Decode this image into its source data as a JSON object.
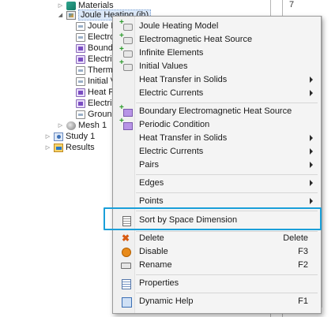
{
  "tree": {
    "items": [
      {
        "label": "Materials",
        "icon": "materials-icon"
      },
      {
        "label": "Joule Heating (jh)",
        "icon": "joule-heating-icon"
      },
      {
        "label": "Joule H",
        "icon": "node-icon"
      },
      {
        "label": "Electro",
        "icon": "node-icon"
      },
      {
        "label": "Bound",
        "icon": "boundary-icon"
      },
      {
        "label": "Electric",
        "icon": "boundary-icon"
      },
      {
        "label": "Therm",
        "icon": "node-icon"
      },
      {
        "label": "Initial V",
        "icon": "node-icon"
      },
      {
        "label": "Heat F",
        "icon": "boundary-icon"
      },
      {
        "label": "Electric",
        "icon": "boundary-icon"
      },
      {
        "label": "Groun",
        "icon": "node-icon"
      },
      {
        "label": "Mesh 1",
        "icon": "mesh-icon"
      },
      {
        "label": "Study 1",
        "icon": "study-icon"
      },
      {
        "label": "Results",
        "icon": "results-icon"
      }
    ]
  },
  "right_panel": {
    "digit": "7"
  },
  "menu": {
    "items": [
      {
        "label": "Joule Heating Model",
        "icon": "domain-node-icon"
      },
      {
        "label": "Electromagnetic Heat Source",
        "icon": "domain-node-icon"
      },
      {
        "label": "Infinite Elements",
        "icon": "domain-node-icon"
      },
      {
        "label": "Initial Values",
        "icon": "domain-node-icon"
      },
      {
        "label": "Heat Transfer in Solids",
        "icon": "",
        "submenu": true
      },
      {
        "label": "Electric Currents",
        "icon": "",
        "submenu": true
      },
      {
        "label": "Boundary Electromagnetic Heat Source",
        "icon": "boundary-node-icon"
      },
      {
        "label": "Periodic Condition",
        "icon": "boundary-node-icon"
      },
      {
        "label": "Heat Transfer in Solids",
        "icon": "",
        "submenu": true
      },
      {
        "label": "Electric Currents",
        "icon": "",
        "submenu": true
      },
      {
        "label": "Pairs",
        "icon": "",
        "submenu": true
      },
      {
        "label": "Edges",
        "icon": "",
        "submenu": true
      },
      {
        "label": "Points",
        "icon": "",
        "submenu": true
      },
      {
        "label": "Sort by Space Dimension",
        "icon": "sort-icon"
      },
      {
        "label": "Delete",
        "icon": "delete-icon",
        "shortcut": "Delete"
      },
      {
        "label": "Disable",
        "icon": "disable-icon",
        "shortcut": "F3"
      },
      {
        "label": "Rename",
        "icon": "rename-icon",
        "shortcut": "F2"
      },
      {
        "label": "Properties",
        "icon": "properties-icon"
      },
      {
        "label": "Dynamic Help",
        "icon": "help-icon",
        "shortcut": "F1"
      }
    ]
  },
  "colors": {
    "highlight_border": "#1a9fd9",
    "delete_icon": "#d85a10",
    "disable_icon": "#e88a1a",
    "add_plus": "#2a9a2a"
  }
}
